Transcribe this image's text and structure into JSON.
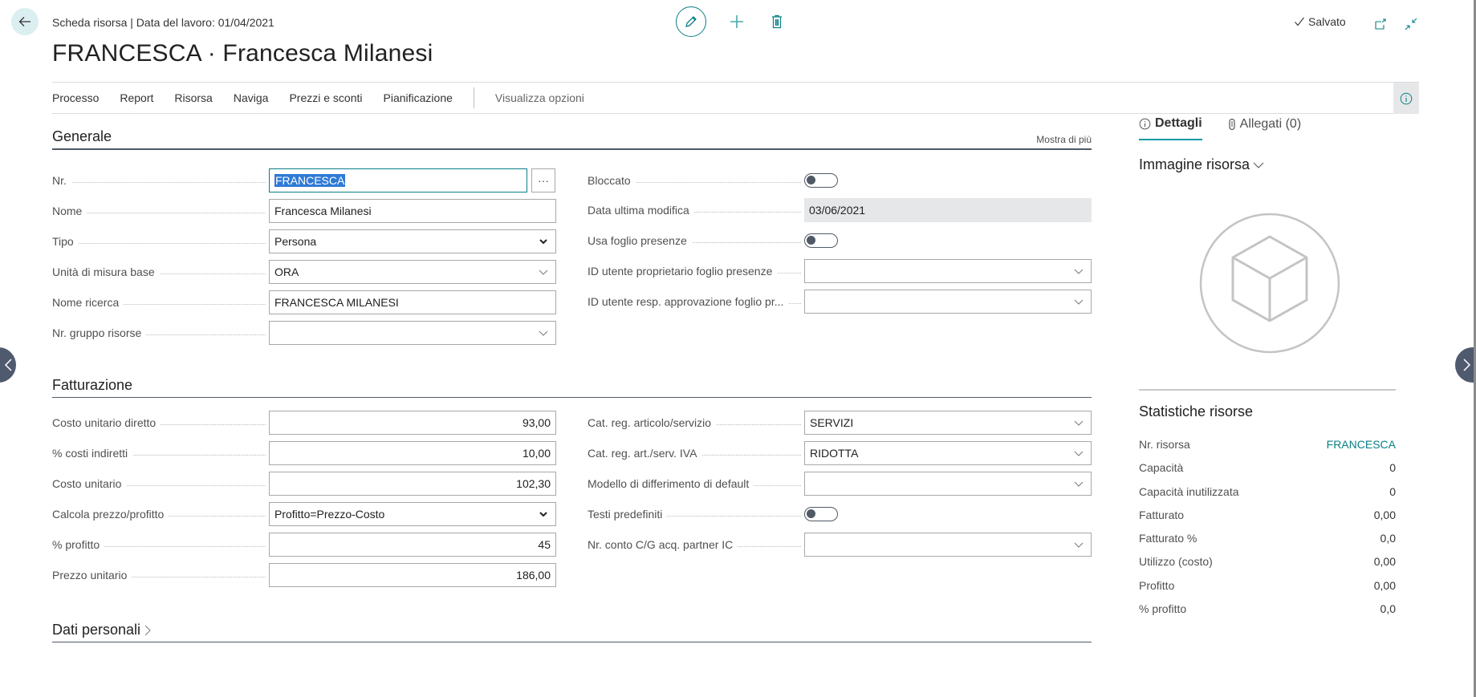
{
  "header": {
    "breadcrumb": "Scheda risorsa | Data del lavoro: 01/04/2021",
    "title": "FRANCESCA · Francesca Milanesi",
    "status": "Salvato",
    "icons": {
      "back": "arrow-left-icon",
      "edit": "pencil-icon",
      "new": "plus-icon",
      "delete": "trash-icon",
      "open_new_window": "open-new-window-icon",
      "collapse": "collapse-icon",
      "saved": "checkmark-icon"
    }
  },
  "action_bar": {
    "items": [
      "Processo",
      "Report",
      "Risorsa",
      "Naviga",
      "Prezzi e sconti",
      "Pianificazione"
    ],
    "view_options": "Visualizza opzioni"
  },
  "generale": {
    "title": "Generale",
    "show_more": "Mostra di più",
    "left": [
      {
        "label": "Nr.",
        "value": "FRANCESCA",
        "type": "text-focused-lookup"
      },
      {
        "label": "Nome",
        "value": "Francesca Milanesi",
        "type": "text"
      },
      {
        "label": "Tipo",
        "value": "Persona",
        "type": "select"
      },
      {
        "label": "Unità di misura base",
        "value": "ORA",
        "type": "lookup"
      },
      {
        "label": "Nome ricerca",
        "value": "FRANCESCA MILANESI",
        "type": "text"
      },
      {
        "label": "Nr. gruppo risorse",
        "value": "",
        "type": "lookup"
      }
    ],
    "right": [
      {
        "label": "Bloccato",
        "value": false,
        "type": "toggle"
      },
      {
        "label": "Data ultima modifica",
        "value": "03/06/2021",
        "type": "readonly"
      },
      {
        "label": "Usa foglio presenze",
        "value": false,
        "type": "toggle"
      },
      {
        "label": "ID utente proprietario foglio presenze",
        "value": "",
        "type": "lookup"
      },
      {
        "label": "ID utente resp. approvazione foglio pr...",
        "value": "",
        "type": "lookup"
      }
    ]
  },
  "fatturazione": {
    "title": "Fatturazione",
    "left": [
      {
        "label": "Costo unitario diretto",
        "value": "93,00"
      },
      {
        "label": "% costi indiretti",
        "value": "10,00"
      },
      {
        "label": "Costo unitario",
        "value": "102,30"
      },
      {
        "label": "Calcola prezzo/profitto",
        "value": "Profitto=Prezzo-Costo"
      },
      {
        "label": "% profitto",
        "value": "45"
      },
      {
        "label": "Prezzo unitario",
        "value": "186,00"
      }
    ],
    "right": [
      {
        "label": "Cat. reg. articolo/servizio",
        "value": "SERVIZI"
      },
      {
        "label": "Cat. reg. art./serv. IVA",
        "value": "RIDOTTA"
      },
      {
        "label": "Modello di differimento di default",
        "value": ""
      },
      {
        "label": "Testi predefiniti",
        "value": false
      },
      {
        "label": "Nr. conto C/G acq. partner IC",
        "value": ""
      }
    ]
  },
  "dati_personali": {
    "title": "Dati personali"
  },
  "factbox": {
    "tabs": [
      {
        "label": "Dettagli",
        "active": true,
        "icon": "info-icon"
      },
      {
        "label": "Allegati (0)",
        "active": false,
        "icon": "paperclip-icon"
      }
    ],
    "image_title": "Immagine risorsa",
    "stats_title": "Statistiche risorse",
    "stats": [
      {
        "label": "Nr. risorsa",
        "value": "FRANCESCA",
        "link": true
      },
      {
        "label": "Capacità",
        "value": "0"
      },
      {
        "label": "Capacità inutilizzata",
        "value": "0"
      },
      {
        "label": "Fatturato",
        "value": "0,00"
      },
      {
        "label": "Fatturato %",
        "value": "0,0"
      },
      {
        "label": "Utilizzo (costo)",
        "value": "0,00"
      },
      {
        "label": "Profitto",
        "value": "0,00"
      },
      {
        "label": "% profitto",
        "value": "0,0"
      }
    ]
  },
  "colors": {
    "accent": "#0a7f86",
    "tab_underline": "#0a9aa3",
    "section_rule": "#505a66",
    "nav_arrow": "#505a6e",
    "selection": "#2f7ad6",
    "readonly_bg": "#e6e7e9"
  }
}
